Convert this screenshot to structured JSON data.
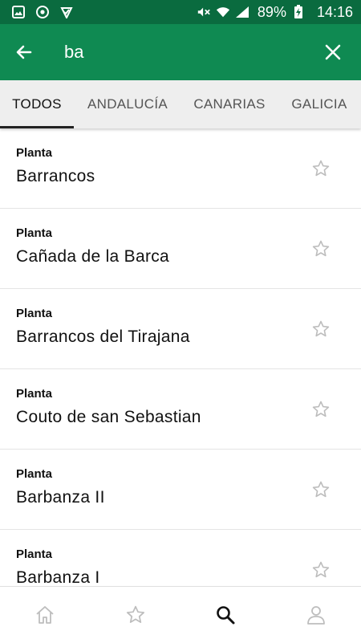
{
  "status_bar": {
    "battery_percent": "89%",
    "time": "14:16",
    "icons": [
      "image-icon",
      "chrome-icon",
      "check-icon",
      "mute-icon",
      "wifi-icon",
      "signal-icon",
      "battery-charging-icon"
    ]
  },
  "app_bar": {
    "search_value": "ba",
    "back_icon": "arrow-left-icon",
    "close_icon": "close-icon",
    "background": "#0f8a52"
  },
  "tabs": [
    {
      "label": "TODOS",
      "active": true
    },
    {
      "label": "ANDALUCÍA",
      "active": false
    },
    {
      "label": "CANARIAS",
      "active": false
    },
    {
      "label": "GALICIA",
      "active": false
    }
  ],
  "results": [
    {
      "type": "Planta",
      "name": "Barrancos",
      "favorite": false
    },
    {
      "type": "Planta",
      "name": "Cañada de la Barca",
      "favorite": false
    },
    {
      "type": "Planta",
      "name": "Barrancos del Tirajana",
      "favorite": false
    },
    {
      "type": "Planta",
      "name": "Couto de san Sebastian",
      "favorite": false
    },
    {
      "type": "Planta",
      "name": "Barbanza II",
      "favorite": false
    },
    {
      "type": "Planta",
      "name": "Barbanza I",
      "favorite": false
    }
  ],
  "bottom_nav": [
    {
      "icon": "home-icon",
      "active": false
    },
    {
      "icon": "star-icon",
      "active": false
    },
    {
      "icon": "search-icon",
      "active": true
    },
    {
      "icon": "user-icon",
      "active": false
    }
  ],
  "colors": {
    "status_bar": "#0a6b3f",
    "app_bar": "#0f8a52",
    "tab_bar": "#eeeeee",
    "icon_inactive": "#bdbdbd",
    "icon_active": "#111111"
  }
}
